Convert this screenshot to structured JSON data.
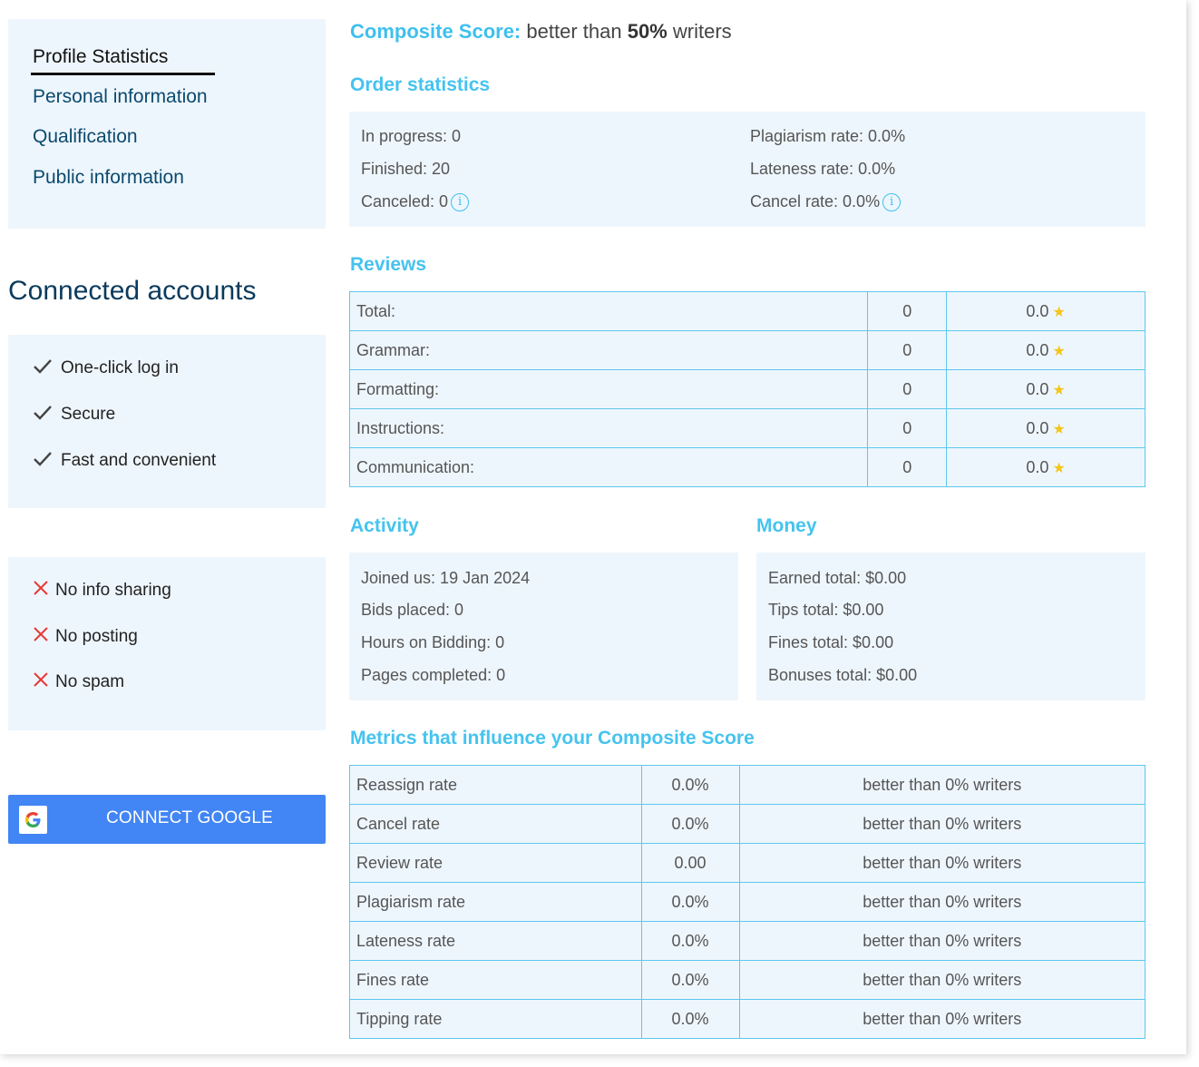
{
  "nav": {
    "items": [
      {
        "label": "Profile Statistics",
        "active": true
      },
      {
        "label": "Personal information"
      },
      {
        "label": "Qualification"
      },
      {
        "label": "Public information"
      }
    ]
  },
  "connected": {
    "title": "Connected accounts",
    "benefits": [
      "One-click log in",
      "Secure",
      "Fast and convenient"
    ],
    "restrictions": [
      "No info sharing",
      "No posting",
      "No spam"
    ],
    "google_button": "CONNECT GOOGLE"
  },
  "composite": {
    "label": "Composite Score:",
    "prefix": "better than",
    "value": "50%",
    "suffix": "writers"
  },
  "order_statistics": {
    "title": "Order statistics",
    "left": [
      "In progress: 0",
      "Finished: 20",
      "Canceled: 0"
    ],
    "right": [
      "Plagiarism rate: 0.0%",
      "Lateness rate: 0.0%",
      "Cancel rate: 0.0%"
    ]
  },
  "reviews": {
    "title": "Reviews",
    "rows": [
      {
        "label": "Total:",
        "count": "0",
        "score": "0.0"
      },
      {
        "label": "Grammar:",
        "count": "0",
        "score": "0.0"
      },
      {
        "label": "Formatting:",
        "count": "0",
        "score": "0.0"
      },
      {
        "label": "Instructions:",
        "count": "0",
        "score": "0.0"
      },
      {
        "label": "Communication:",
        "count": "0",
        "score": "0.0"
      }
    ]
  },
  "activity": {
    "title": "Activity",
    "items": [
      "Joined us: 19 Jan 2024",
      "Bids placed: 0",
      "Hours on Bidding: 0",
      "Pages completed: 0"
    ]
  },
  "money": {
    "title": "Money",
    "items": [
      "Earned total: $0.00",
      "Tips total: $0.00",
      "Fines total: $0.00",
      "Bonuses total: $0.00"
    ]
  },
  "metrics": {
    "title": "Metrics that influence your Composite Score",
    "rows": [
      {
        "name": "Reassign rate",
        "value": "0.0%",
        "compare": "better than 0% writers"
      },
      {
        "name": "Cancel rate",
        "value": "0.0%",
        "compare": "better than 0% writers"
      },
      {
        "name": "Review rate",
        "value": "0.00",
        "compare": "better than 0% writers"
      },
      {
        "name": "Plagiarism rate",
        "value": "0.0%",
        "compare": "better than 0% writers"
      },
      {
        "name": "Lateness rate",
        "value": "0.0%",
        "compare": "better than 0% writers"
      },
      {
        "name": "Fines rate",
        "value": "0.0%",
        "compare": "better than 0% writers"
      },
      {
        "name": "Tipping rate",
        "value": "0.0%",
        "compare": "better than 0% writers"
      }
    ]
  },
  "colors": {
    "accent": "#45c3ef",
    "panel_bg": "#eef6fd",
    "nav_text": "#0b4a6e",
    "google_blue": "#4285f4",
    "check": "#444444",
    "cross": "#e53935",
    "star": "#f5c518"
  }
}
